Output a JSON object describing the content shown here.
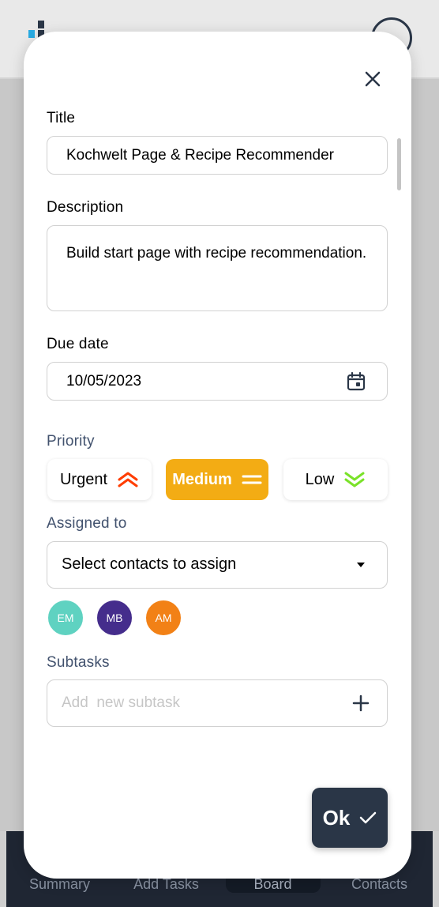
{
  "background": {
    "nav": [
      "Summary",
      "Add Tasks",
      "Board",
      "Contacts"
    ],
    "active_nav": "Board"
  },
  "form": {
    "title_label": "Title",
    "title_value": "Kochwelt Page & Recipe Recommender",
    "description_label": "Description",
    "description_value": "Build start page with recipe recommendation.",
    "due_date_label": "Due date",
    "due_date_value": "10/05/2023",
    "priority_label": "Priority",
    "priority": {
      "urgent": "Urgent",
      "medium": "Medium",
      "low": "Low",
      "selected": "Medium"
    },
    "assigned_label": "Assigned to",
    "assigned_placeholder": "Select contacts to assign",
    "assignees": [
      {
        "initials": "EM",
        "color": "#5fd2c1"
      },
      {
        "initials": "MB",
        "color": "#452d8c"
      },
      {
        "initials": "AM",
        "color": "#f28116"
      }
    ],
    "subtasks_label": "Subtasks",
    "subtask_placeholder": "Add  new subtask",
    "ok_label": "Ok"
  },
  "colors": {
    "primary": "#2a3647",
    "urgent": "#ff3d00",
    "medium": "#f3ac14",
    "low": "#7ae229"
  }
}
